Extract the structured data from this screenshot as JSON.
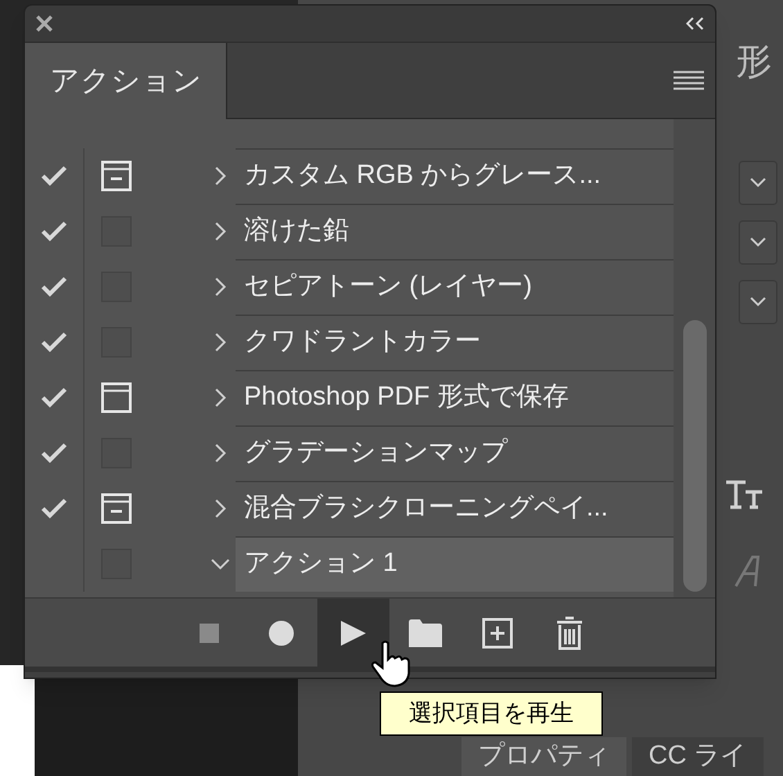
{
  "panel": {
    "tab": {
      "label": "アクション",
      "selected": true
    }
  },
  "actions": [
    {
      "name": "カスタム RGB からグレース...",
      "checked": true,
      "kind": "line",
      "expanded": false,
      "selected": false
    },
    {
      "name": "溶けた鉛",
      "checked": true,
      "kind": "off",
      "expanded": false,
      "selected": false
    },
    {
      "name": "セピアトーン (レイヤー)",
      "checked": true,
      "kind": "off",
      "expanded": false,
      "selected": false
    },
    {
      "name": "クワドラントカラー",
      "checked": true,
      "kind": "off",
      "expanded": false,
      "selected": false
    },
    {
      "name": "Photoshop PDF 形式で保存",
      "checked": true,
      "kind": "bar",
      "expanded": false,
      "selected": false
    },
    {
      "name": "グラデーションマップ",
      "checked": true,
      "kind": "off",
      "expanded": false,
      "selected": false
    },
    {
      "name": "混合ブラシクローニングペイ...",
      "checked": true,
      "kind": "line",
      "expanded": false,
      "selected": false
    },
    {
      "name": "アクション 1",
      "checked": false,
      "kind": "off",
      "expanded": true,
      "selected": true
    }
  ],
  "toolbar": [
    {
      "kind": "stop",
      "disabled": true,
      "highlighted": false
    },
    {
      "kind": "record",
      "disabled": false,
      "highlighted": false
    },
    {
      "kind": "play",
      "disabled": false,
      "highlighted": true
    },
    {
      "kind": "folder",
      "disabled": false,
      "highlighted": false
    },
    {
      "kind": "new",
      "disabled": false,
      "highlighted": false
    },
    {
      "kind": "delete",
      "disabled": false,
      "highlighted": false
    }
  ],
  "tooltip": "選択項目を再生",
  "background": {
    "glyph": "形",
    "tabs": [
      {
        "label": "プロパティ",
        "selected": true
      },
      {
        "label": "CC ライ",
        "selected": false
      }
    ]
  }
}
